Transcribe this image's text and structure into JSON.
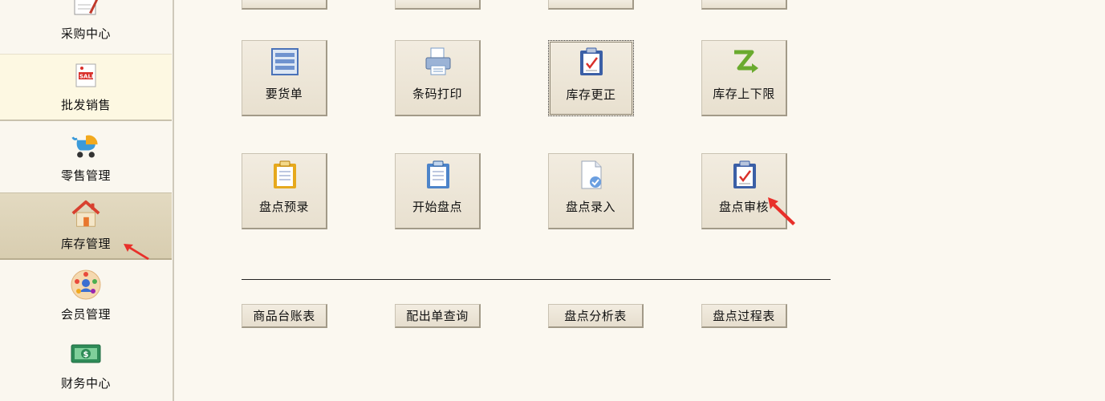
{
  "sidebar": {
    "items": [
      {
        "label": "采购中心",
        "icon": "purchase-order-icon"
      },
      {
        "label": "批发销售",
        "icon": "sale-tag-icon"
      },
      {
        "label": "零售管理",
        "icon": "stroller-icon"
      },
      {
        "label": "库存管理",
        "icon": "house-icon"
      },
      {
        "label": "会员管理",
        "icon": "members-icon"
      },
      {
        "label": "财务中心",
        "icon": "money-icon"
      }
    ]
  },
  "tiles": {
    "row1": [
      {
        "label": "要货单",
        "icon": "list-icon"
      },
      {
        "label": "条码打印",
        "icon": "printer-icon"
      },
      {
        "label": "库存更正",
        "icon": "clipboard-check-icon"
      },
      {
        "label": "库存上下限",
        "icon": "limit-z-icon"
      }
    ],
    "row2": [
      {
        "label": "盘点预录",
        "icon": "clipboard-yellow-icon"
      },
      {
        "label": "开始盘点",
        "icon": "clipboard-blue-icon"
      },
      {
        "label": "盘点录入",
        "icon": "document-check-icon"
      },
      {
        "label": "盘点审核",
        "icon": "clipboard-check-icon"
      }
    ]
  },
  "reports": [
    {
      "label": "商品台账表"
    },
    {
      "label": "配出单查询"
    },
    {
      "label": "盘点分析表"
    },
    {
      "label": "盘点过程表"
    }
  ],
  "colors": {
    "background": "#fbf8f0",
    "tile": "#ece5d6",
    "active_nav": "#ddd3b8",
    "cursor_arrow": "#e8302a"
  }
}
